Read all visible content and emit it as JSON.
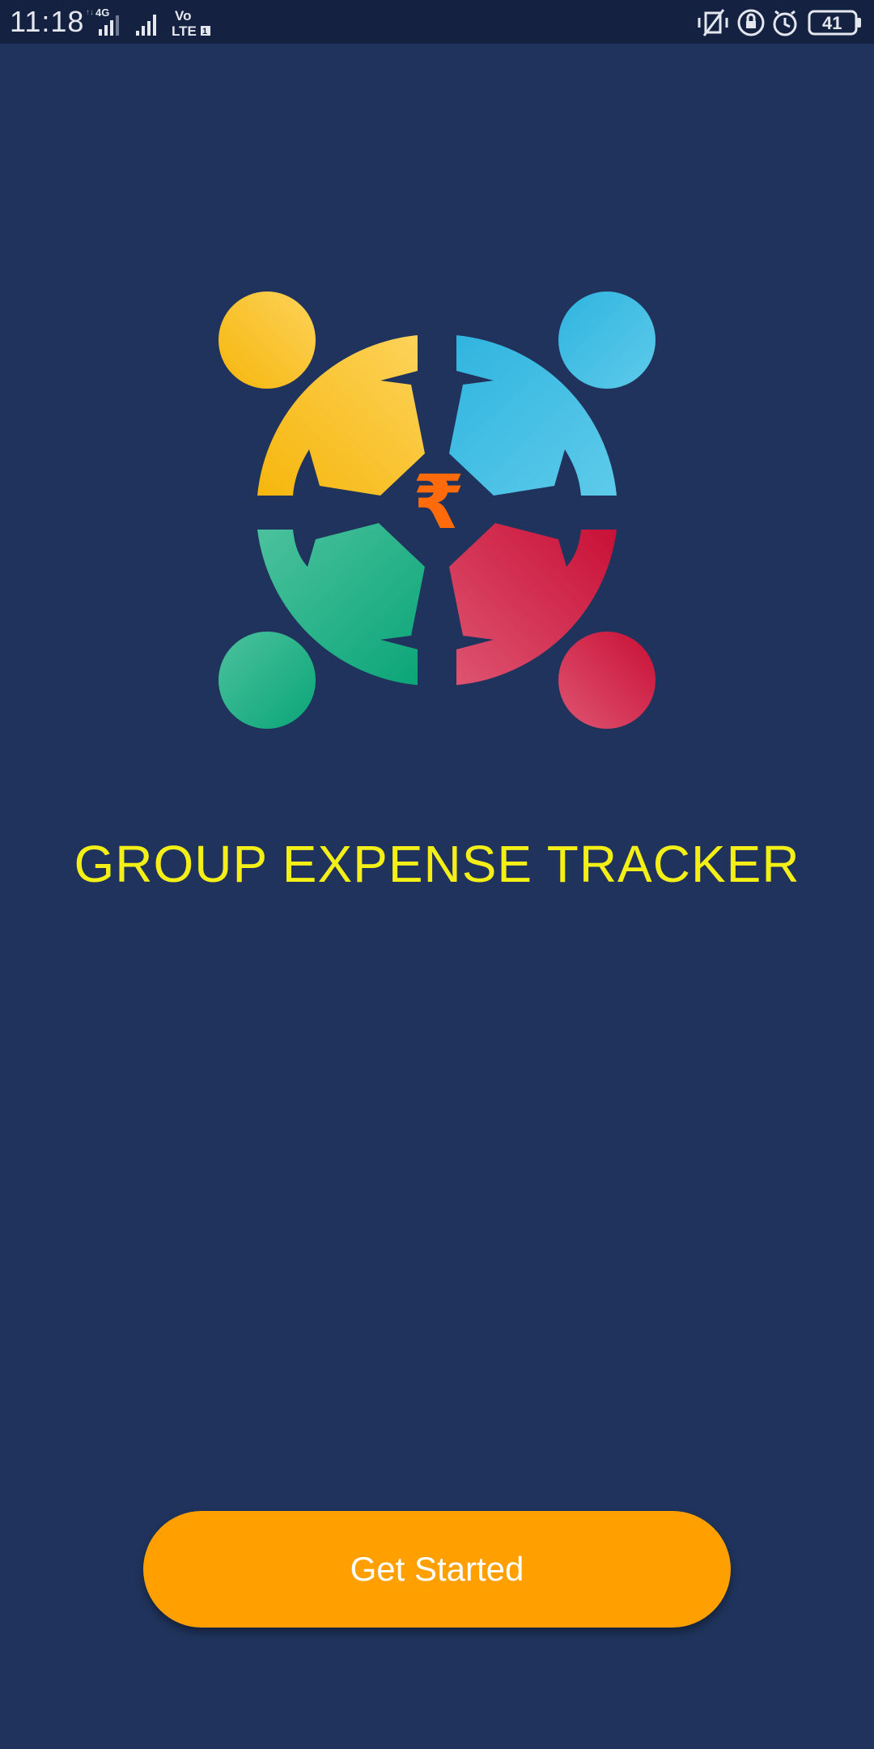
{
  "status_bar": {
    "time": "11:18",
    "network_type": "4G",
    "volte_label": "Vo",
    "lte_label": "LTE",
    "sim_slot": "1",
    "battery_level": "41",
    "icons": [
      "signal-4g-icon",
      "signal-icon",
      "volte-icon",
      "vibrate-icon",
      "rotation-lock-icon",
      "alarm-icon",
      "battery-icon"
    ]
  },
  "logo": {
    "icon": "group-people-rupee-logo",
    "currency_symbol": "₹",
    "colors": {
      "yellow": "#fbbf24",
      "blue": "#3cbde3",
      "green": "#1fb087",
      "red": "#d8264a",
      "rupee": "#ff6a0a"
    }
  },
  "app_title": "GROUP EXPENSE TRACKER",
  "primary_action": {
    "label": "Get Started"
  },
  "colors": {
    "background": "#1f335c",
    "status_bar": "#142140",
    "title": "#f5ef18",
    "button": "#ffa000",
    "button_text": "#ffffff"
  }
}
